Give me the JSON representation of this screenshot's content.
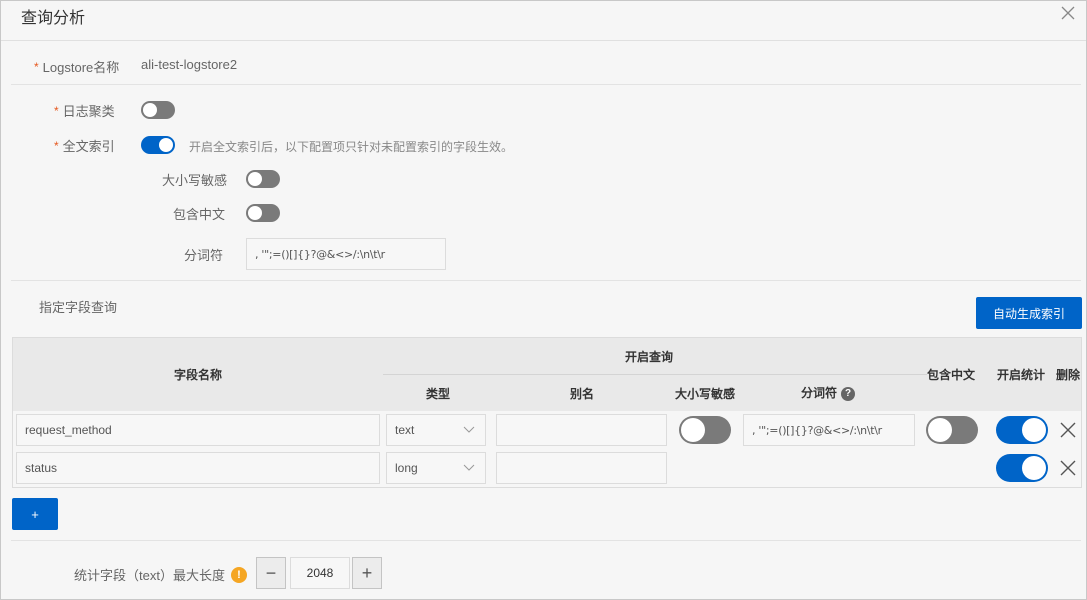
{
  "dialog": {
    "title": "查询分析",
    "close_icon": "close-icon"
  },
  "logstore": {
    "label": "Logstore名称",
    "required_mark": "*",
    "value": "ali-test-logstore2"
  },
  "log_cluster": {
    "label": "日志聚类",
    "required_mark": "*",
    "enabled": false
  },
  "full_text_index": {
    "label": "全文索引",
    "required_mark": "*",
    "enabled": true,
    "hint": "开启全文索引后，以下配置项只针对未配置索引的字段生效。",
    "case_sensitive": {
      "label": "大小写敏感",
      "enabled": false
    },
    "include_chinese": {
      "label": "包含中文",
      "enabled": false
    },
    "delimiter": {
      "label": "分词符",
      "value": ", '\";=()[]{}?@&<>/:\\n\\t\\r"
    }
  },
  "field_query": {
    "section_title": "指定字段查询",
    "auto_generate_button": "自动生成索引",
    "add_button": "+",
    "columns": {
      "field_name": "字段名称",
      "enable_query": "开启查询",
      "type": "类型",
      "alias": "别名",
      "case_sensitive": "大小写敏感",
      "delimiter": "分词符",
      "include_chinese": "包含中文",
      "enable_stats": "开启统计",
      "delete": "删除"
    },
    "rows": [
      {
        "field_name": "request_method",
        "type": "text",
        "alias": "",
        "case_sensitive": false,
        "delimiter": ", '\";=()[]{}?@&<>/:\\n\\t\\r",
        "include_chinese": false,
        "enable_stats": true
      },
      {
        "field_name": "status",
        "type": "long",
        "alias": "",
        "enable_stats": true
      }
    ]
  },
  "stats_max_length": {
    "label": "统计字段（text）最大长度",
    "value": "2048",
    "decrement": "−",
    "increment": "+",
    "warn_icon": "!"
  },
  "colors": {
    "primary": "#0064c8",
    "required": "#e5581f",
    "switch_off": "#7a7a7a",
    "warning": "#f5a623"
  }
}
